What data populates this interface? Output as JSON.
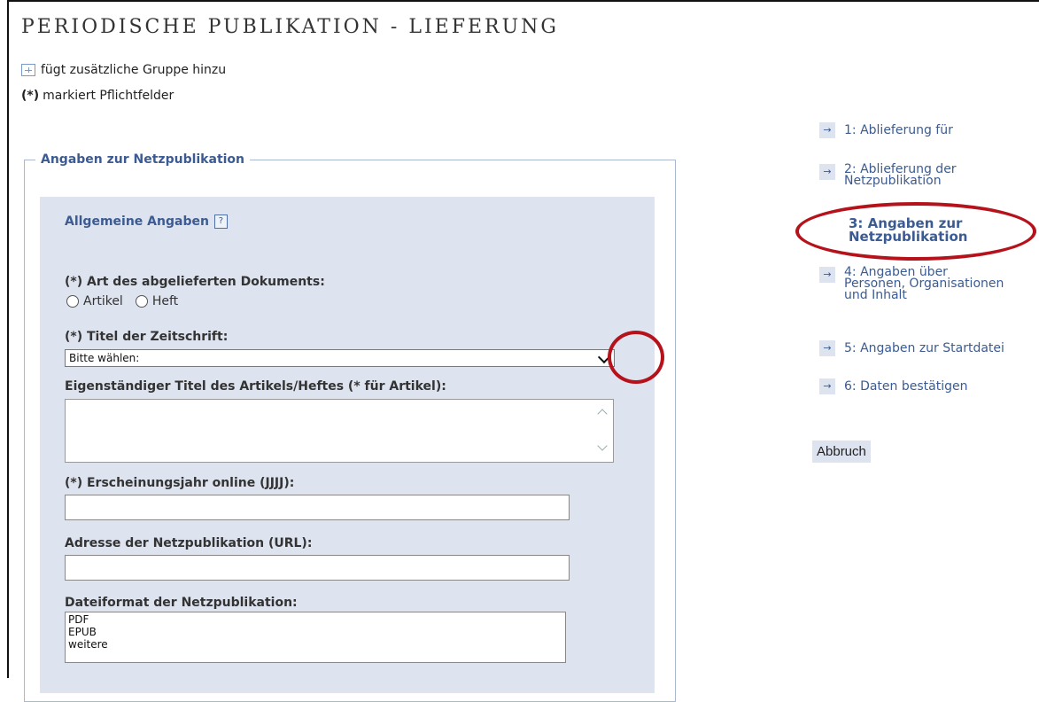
{
  "page": {
    "title": "PERIODISCHE PUBLIKATION - LIEFERUNG",
    "legend_add_group": "fügt zusätzliche Gruppe hinzu",
    "legend_required_mark": "(*)",
    "legend_required_text": "markiert Pflichtfelder"
  },
  "fieldset": {
    "legend": "Angaben zur Netzpublikation",
    "group_title": "Allgemeine Angaben",
    "help_icon_text": "?"
  },
  "fields": {
    "doc_type_label": "(*) Art des abgelieferten Dokuments:",
    "doc_type_options": [
      "Artikel",
      "Heft"
    ],
    "journal_title_label": "(*) Titel der Zeitschrift:",
    "journal_title_value": "Bitte wählen:",
    "own_title_label": "Eigenständiger Titel des Artikels/Heftes (* für Artikel):",
    "year_label": "(*) Erscheinungsjahr online (JJJJ):",
    "url_label": "Adresse der Netzpublikation (URL):",
    "format_label": "Dateiformat der Netzpublikation:",
    "format_options": [
      "PDF",
      "EPUB",
      "weitere"
    ]
  },
  "side_nav": {
    "items": [
      {
        "label": "1: Ablieferung für"
      },
      {
        "label_line1": "2: Ablieferung der",
        "label_line2": "Netzpublikation"
      },
      {
        "label_line1": "3: Angaben zur",
        "label_line2": "Netzpublikation",
        "active": true
      },
      {
        "label_line1": "4: Angaben über",
        "label_line2": "Personen, Organisationen",
        "label_line3": "und Inhalt"
      },
      {
        "label": "5: Angaben zur Startdatei"
      },
      {
        "label": "6: Daten bestätigen"
      }
    ],
    "arrow_glyph": "→",
    "cancel_label": "Abbruch"
  },
  "annotation_color": "#b5121b"
}
